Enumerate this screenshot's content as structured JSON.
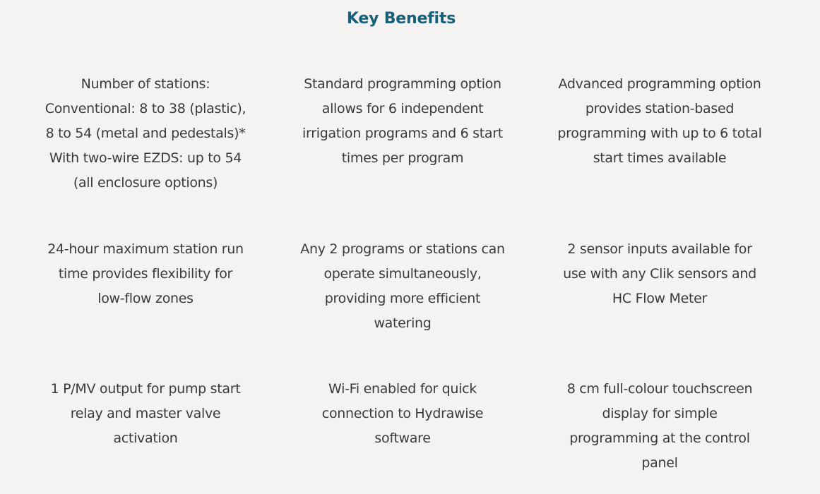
{
  "section": {
    "title": "Key Benefits",
    "title_color": "#15607a",
    "text_color": "#3a3a3a",
    "background": "#f4f3f2"
  },
  "benefits": [
    {
      "lines": [
        "Number of stations:",
        "Conventional: 8 to 38 (plastic),",
        "8 to 54 (metal and pedestals)*",
        "With two-wire EZDS: up to 54",
        "(all enclosure options)"
      ]
    },
    {
      "lines": [
        "Standard programming option",
        "allows for 6 independent",
        "irrigation programs and 6 start",
        "times per program"
      ]
    },
    {
      "lines": [
        "Advanced programming option",
        "provides station-based",
        "programming with up to 6 total",
        "start times available"
      ]
    },
    {
      "lines": [
        "24-hour maximum station run",
        "time provides flexibility for",
        "low-flow zones"
      ]
    },
    {
      "lines": [
        "Any 2 programs or stations can",
        "operate simultaneously,",
        "providing more efficient",
        "watering"
      ]
    },
    {
      "lines": [
        "2 sensor inputs available for",
        "use with any Clik sensors and",
        "HC Flow Meter"
      ]
    },
    {
      "lines": [
        "1 P/MV output for pump start",
        "relay and master valve",
        "activation"
      ]
    },
    {
      "lines": [
        "Wi-Fi enabled for quick",
        "connection to Hydrawise",
        "software"
      ]
    },
    {
      "lines": [
        "8 cm full-colour touchscreen",
        "display for simple",
        "programming at the control",
        "panel"
      ]
    }
  ]
}
